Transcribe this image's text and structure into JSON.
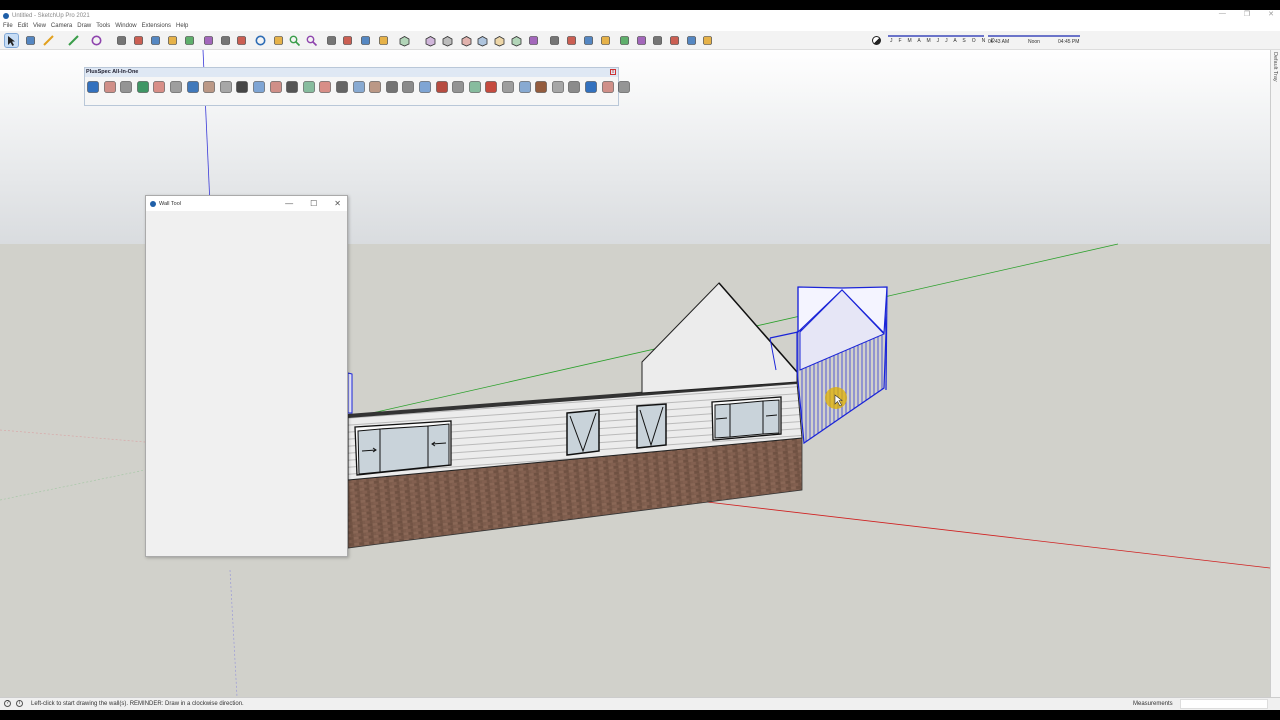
{
  "window": {
    "title": "Untitled - SketchUp Pro 2021",
    "minimize": "—",
    "restore": "❐",
    "close": "✕"
  },
  "menu": [
    "File",
    "Edit",
    "View",
    "Camera",
    "Draw",
    "Tools",
    "Window",
    "Extensions",
    "Help"
  ],
  "toolbar": {
    "tools": [
      "select-icon",
      "eraser-icon",
      "pencil-line-icon",
      "arc-icon",
      "circle-icon",
      "push-pull-icon",
      "follow-me-icon",
      "move-icon",
      "rotate-icon",
      "scale-icon",
      "tape-measure-icon",
      "dimension-icon",
      "paint-bucket-icon",
      "orbit-icon",
      "pan-icon",
      "zoom-icon",
      "zoom-extents-icon",
      "styles-icon",
      "layers-icon",
      "section-icon",
      "shadows-icon",
      "iso-view-icon",
      "top-view-icon",
      "front-view-icon",
      "right-view-icon",
      "back-view-icon",
      "left-view-icon",
      "bottom-view-icon",
      "parallel-icon",
      "walk-icon",
      "look-around-icon",
      "position-camera-icon",
      "xray-icon",
      "back-edges-icon",
      "wireframe-icon",
      "hidden-line-icon",
      "shaded-icon",
      "shaded-textures-icon",
      "monochrome-icon"
    ],
    "active_tool": "select-icon"
  },
  "shadow_settings": {
    "months": "J F M A M J J A S O N D",
    "sunrise": "06:43 AM",
    "noon": "Noon",
    "sunset": "04:45 PM"
  },
  "plusspec": {
    "title": "PlusSpec All-In-One",
    "close": "x",
    "buttons": [
      "2d-ezi-icon",
      "estimate-icon",
      "report-icon",
      "clash-icon",
      "render-icon",
      "block-icon",
      "layers-icon",
      "tag-icon",
      "paint-icon",
      "truss-icon",
      "wall-tool-icon",
      "door-icon",
      "window-icon",
      "column-icon",
      "beam-icon",
      "stair-icon",
      "joist-icon",
      "roof-icon",
      "floor-icon",
      "slab-icon",
      "footing-icon",
      "schedule-icon",
      "grid-icon",
      "framing-icon",
      "site-icon",
      "color-icon",
      "refresh-icon",
      "dollar-icon",
      "bim-icon",
      "tools-icon",
      "help-icon",
      "see-all-icon",
      "ifc-icon"
    ]
  },
  "tray": {
    "label": "Default Tray"
  },
  "wall_tool": {
    "title": "Wall Tool",
    "minimize": "—",
    "maximize": "☐",
    "close": "✕"
  },
  "status": {
    "message": "Left-click to start drawing the wall(s). REMINDER: Draw in a clockwise direction.",
    "measurements_label": "Measurements",
    "measurements_value": ""
  },
  "colors": {
    "sky_top": "#ffffff",
    "sky_bottom": "#d9dcdf",
    "ground": "#d1d1cb",
    "brick": "#7a5a4a",
    "cladding": "#e8e8e8",
    "selection": "#1a24d8",
    "axis_red": "#d02020",
    "axis_green": "#2aa02a",
    "axis_blue": "#2a2ad0",
    "cursor": "#e0b000"
  }
}
